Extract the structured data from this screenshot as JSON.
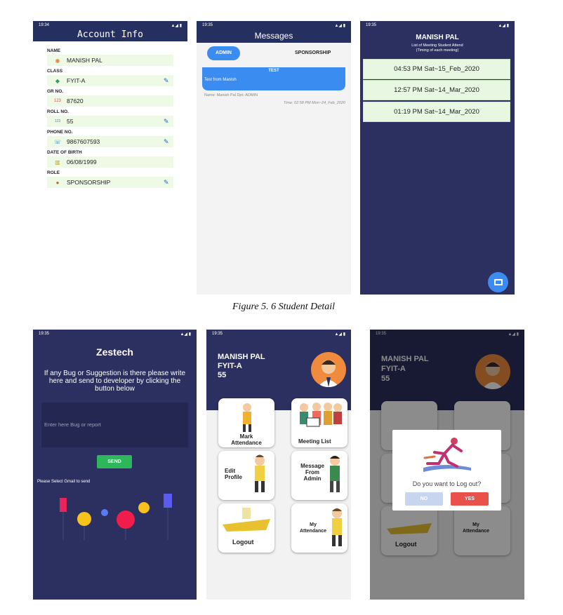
{
  "account": {
    "time": "19:34",
    "title": "Account Info",
    "fields": [
      {
        "label": "NAME",
        "value": "MANISH PAL",
        "icon": "avatar-icon",
        "editable": false
      },
      {
        "label": "CLASS",
        "value": "FYIT-A",
        "icon": "graduation-cap-icon",
        "editable": true
      },
      {
        "label": "GR NO.",
        "value": "87620",
        "icon": "number-icon",
        "editable": false
      },
      {
        "label": "ROLL NO.",
        "value": "55",
        "icon": "number-icon",
        "editable": true
      },
      {
        "label": "PHONE NO.",
        "value": "9867607593",
        "icon": "phone-icon",
        "editable": true
      },
      {
        "label": "DATE OF BIRTH",
        "value": "06/08/1999",
        "icon": "cake-icon",
        "editable": false
      },
      {
        "label": "ROLE",
        "value": "SPONSORSHIP",
        "icon": "person-icon",
        "editable": true
      }
    ]
  },
  "messages": {
    "time": "19:35",
    "title": "Messages",
    "tabs": [
      "ADMIN",
      "SPONSORSHIP"
    ],
    "card": {
      "title": "TEST",
      "body": "Test from Manish",
      "meta": "Name: Manish Pal    Dpt:-ADMIN",
      "time": "Time: 02:58 PM Mon~24_Feb_2020"
    }
  },
  "meetings": {
    "time": "19:35",
    "name": "MANISH PAL",
    "subtitle_1": "List of Meeting Student Attend",
    "subtitle_2": "(Timing of each meeting)",
    "items": [
      "04:53 PM Sat~15_Feb_2020",
      "12:57 PM Sat~14_Mar_2020",
      "01:19 PM Sat~14_Mar_2020"
    ]
  },
  "caption": "Figure 5. 6 Student Detail",
  "feedback": {
    "time": "19:35",
    "title": "Zestech",
    "text": "If any Bug or Suggestion is there please write here and send to developer by clicking the button below",
    "placeholder": "Enter here Bug or report",
    "send": "SEND",
    "note": "Please Select Gmail to send"
  },
  "home": {
    "time": "19:35",
    "name": "MANISH PAL",
    "class": "FYIT-A",
    "roll": "55",
    "cards": [
      "Mark Attendance",
      "Meeting List",
      "Edit Profile",
      "Message From Admin",
      "Logout",
      "My Attendance"
    ]
  },
  "logout": {
    "time": "19:35",
    "name": "MANISH PAL",
    "class": "FYIT-A",
    "roll": "55",
    "question": "Do you want to Log out?",
    "no": "NO",
    "yes": "YES",
    "cards": [
      "Logout",
      "My Attendance"
    ]
  },
  "colors": {
    "navy": "#2c3060",
    "accent": "#3a8cf0",
    "green": "#2db65a",
    "red": "#e8524a"
  }
}
